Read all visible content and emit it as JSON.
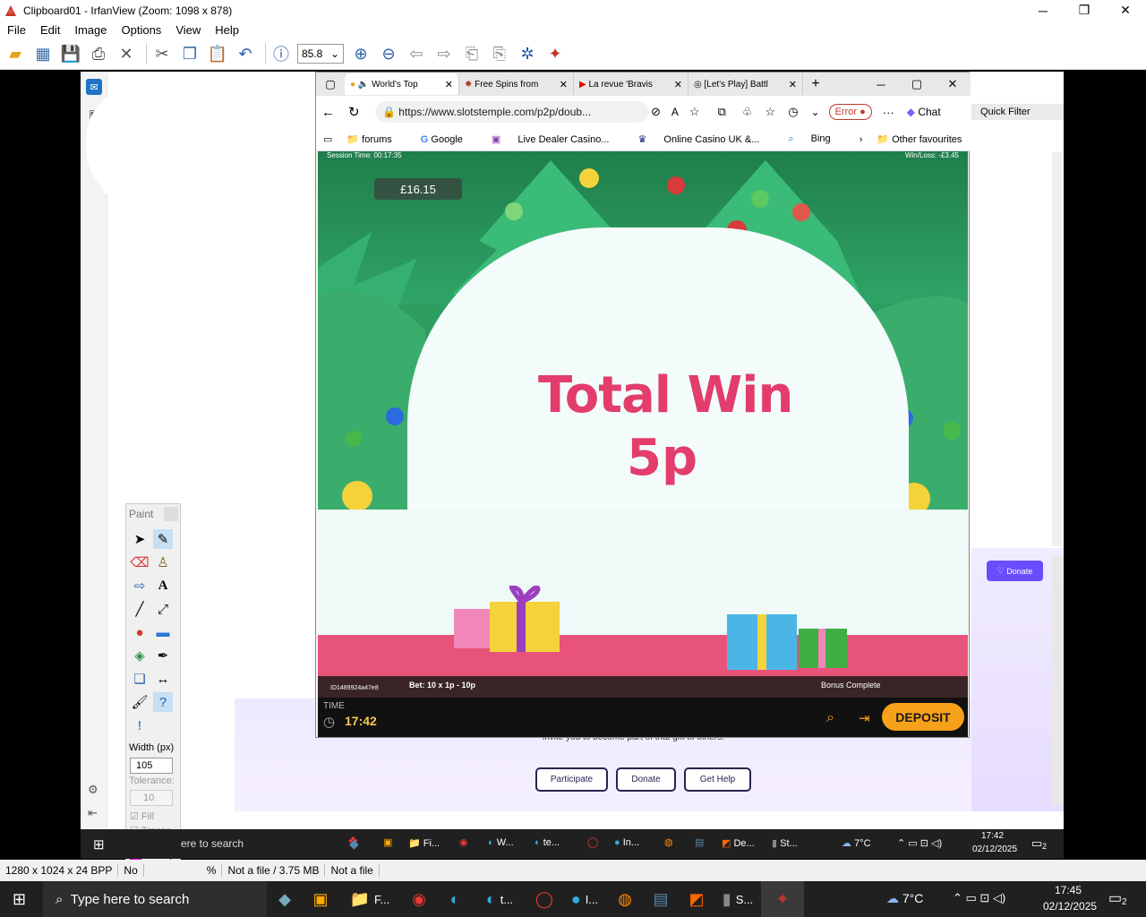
{
  "window": {
    "title": "Clipboard01 - IrfanView (Zoom: 1098 x 878)",
    "minimize": "─",
    "maximize": "❐",
    "close": "✕"
  },
  "menu": [
    "File",
    "Edit",
    "Image",
    "Options",
    "View",
    "Help"
  ],
  "toolbar": {
    "zoom_value": "85.8"
  },
  "edge": {
    "tabs": [
      {
        "label": "World's Top"
      },
      {
        "label": "Free Spins from"
      },
      {
        "label": "La revue 'Bravis"
      },
      {
        "label": "[Let's Play] Battl"
      }
    ],
    "url": "https://www.slotstemple.com/p2p/doub...",
    "error_label": "Error",
    "chat_label": "Chat",
    "favourites": [
      "forums",
      "Google",
      "Live Dealer Casino...",
      "Online Casino UK &...",
      "Bing"
    ],
    "other_favourites": "Other favourites"
  },
  "game": {
    "session_time": "Session Time: 00:17:35",
    "win_loss": "Win/Loss: -£3.45",
    "balance": "£16.15",
    "total_win_label": "Total Win",
    "total_win_value": "5p",
    "round_id": "ID1489924a47e8",
    "bet": "Bet: 10 x 1p - 10p",
    "bonus_status": "Bonus Complete",
    "time_label": "TIME",
    "clock": "17:42",
    "deposit": "DEPOSIT"
  },
  "background_page": {
    "quick_filter": "Quick Filter",
    "donate_side": "Donate",
    "invite_text": "invite you to become part of that gift to others.",
    "buttons": [
      "Participate",
      "Donate",
      "Get Help"
    ]
  },
  "paint": {
    "title": "Paint",
    "width_label": "Width (px)",
    "width_value": "105",
    "tolerance_label": "Tolerance:",
    "tolerance_value": "10",
    "fill_label": "Fill",
    "transp_label": "Transp."
  },
  "inner_taskbar": {
    "search_text": "ere to search",
    "items": [
      "Fi...",
      "W...",
      "te...",
      "In...",
      "De...",
      "St..."
    ],
    "temp": "7°C",
    "time": "17:42",
    "date": "02/12/2025",
    "notifications": "2"
  },
  "status": {
    "dimensions": "1280 x 1024 x 24 BPP",
    "no": "No",
    "pct": "%",
    "file": "Not a file / 3.75 MB",
    "not_file": "Not a file"
  },
  "taskbar": {
    "search_placeholder": "Type here to search",
    "items": [
      "F...",
      "t...",
      "I...",
      "S..."
    ],
    "temp": "7°C",
    "time": "17:45",
    "date": "02/12/2025",
    "notifications": "2"
  },
  "colors": {
    "accent_pink": "#e23d6c",
    "deposit": "#f7a11a",
    "magenta": "#ff00ff"
  }
}
